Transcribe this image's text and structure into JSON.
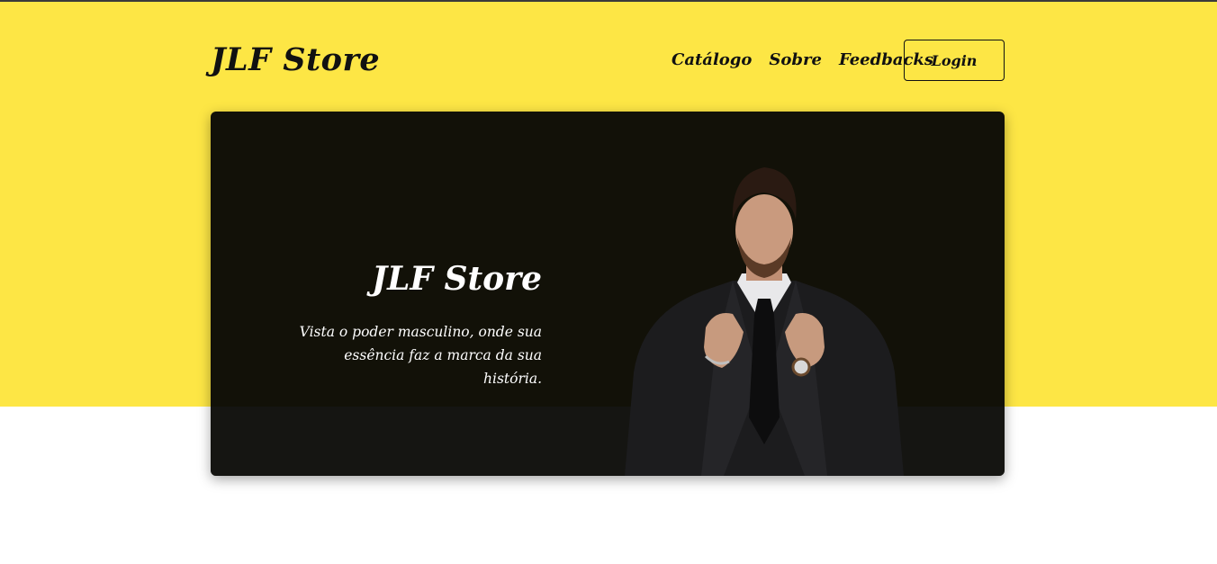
{
  "header": {
    "brand": "JLF Store",
    "nav": [
      {
        "label": "Catálogo"
      },
      {
        "label": "Sobre"
      },
      {
        "label": "Feedbacks"
      }
    ],
    "login_label": "Login"
  },
  "hero": {
    "title": "JLF Store",
    "subtitle": "Vista o poder masculino, onde sua essência faz a marca da sua história."
  },
  "colors": {
    "accent_yellow": "#fde645",
    "hero_background": "#121108",
    "text_dark": "#111111"
  }
}
